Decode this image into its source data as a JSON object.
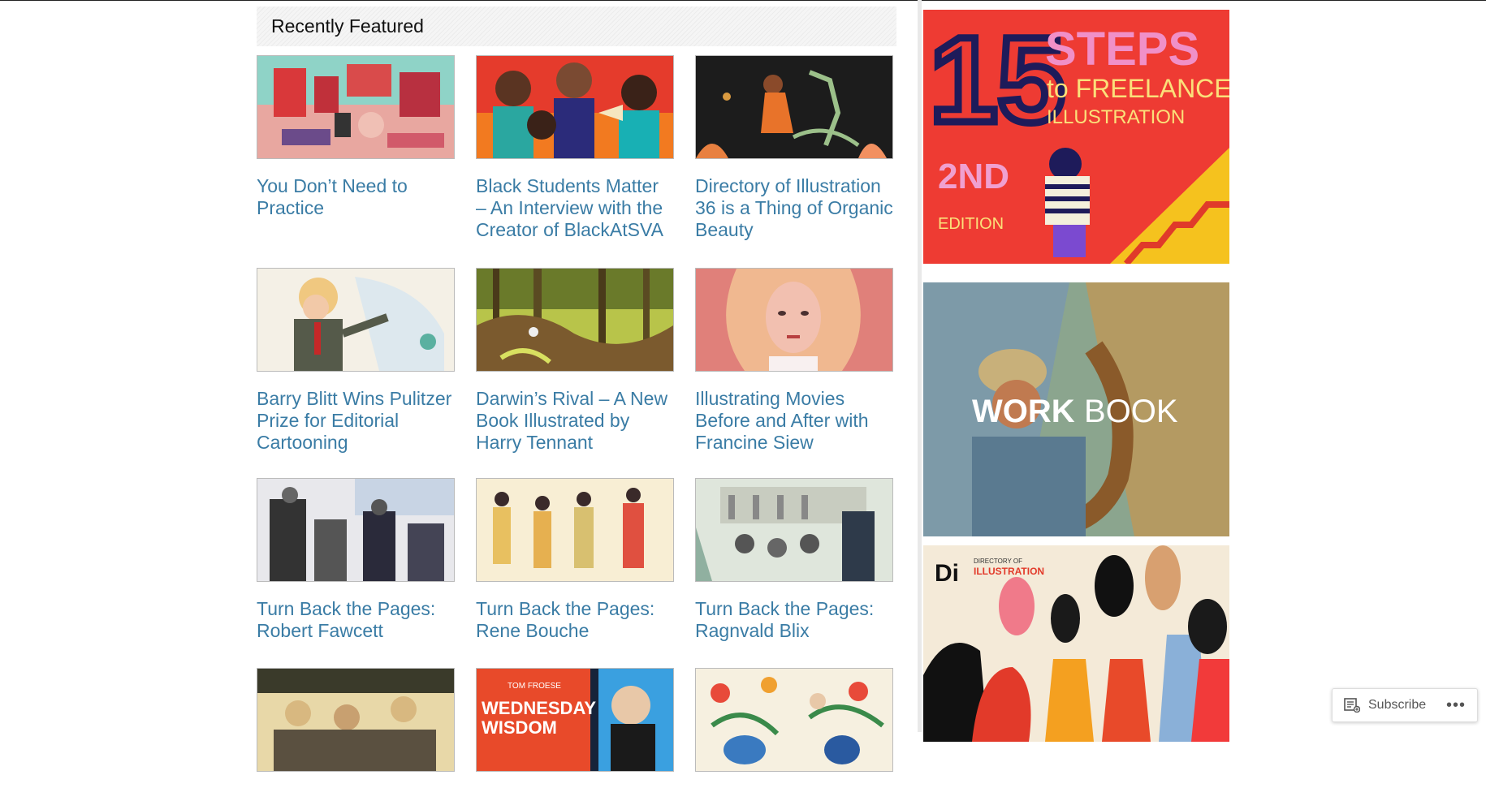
{
  "section": {
    "title": "Recently Featured"
  },
  "posts": [
    {
      "title": "You Don’t Need to Practice"
    },
    {
      "title": "Black Students Matter – An Interview with the Creator of BlackAtSVA"
    },
    {
      "title": "Directory of Illustration 36 is a Thing of Organic Beauty"
    },
    {
      "title": "Barry Blitt Wins Pulitzer Prize for Editorial Cartooning"
    },
    {
      "title": "Darwin’s Rival – A New Book Illustrated by Harry Tennant"
    },
    {
      "title": "Illustrating Movies Before and After with Francine Siew"
    },
    {
      "title": "Turn Back the Pages: Robert Fawcett"
    },
    {
      "title": "Turn Back the Pages: Rene Bouche"
    },
    {
      "title": "Turn Back the Pages: Ragnvald Blix"
    },
    {
      "title": ""
    },
    {
      "title": ""
    },
    {
      "title": ""
    }
  ],
  "thumb_text": {
    "post_11_line1": "TOM FROESE",
    "post_11_line2": "WEDNESDAY",
    "post_11_line3": "WISDOM"
  },
  "sidebar": {
    "ad1": {
      "number": "15",
      "word1": "STEPS",
      "word2": "to FREELANCE",
      "word3": "ILLUSTRATION",
      "edition1": "2ND",
      "edition2": "EDITION"
    },
    "ad2": {
      "brand_bold": "WORK",
      "brand_light": "BOOK"
    },
    "ad3": {
      "logo": "Di",
      "line1": "DIRECTORY OF",
      "line2": "ILLUSTRATION"
    }
  },
  "subscribe": {
    "label": "Subscribe",
    "more": "•••"
  },
  "colors": {
    "link": "#3a7ca5",
    "ad1_bg": "#ee3b33"
  }
}
